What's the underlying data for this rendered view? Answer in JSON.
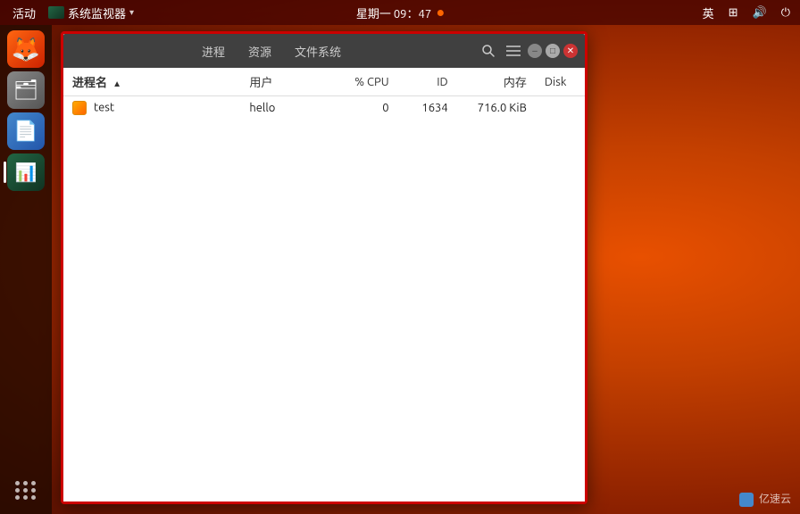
{
  "topbar": {
    "activities": "活动",
    "app_title": "系统监视器",
    "datetime": "星期一 09：47",
    "lang": "英",
    "icons": {
      "network": "network-icon",
      "volume": "volume-icon",
      "power": "power-icon"
    }
  },
  "sidebar": {
    "items": [
      {
        "name": "firefox",
        "label": "Firefox"
      },
      {
        "name": "files",
        "label": "文件管理器"
      },
      {
        "name": "writer",
        "label": "LibreOffice Writer"
      },
      {
        "name": "monitor",
        "label": "系统监视器",
        "active": true
      }
    ],
    "apps_grid_label": "显示应用程序"
  },
  "window": {
    "title": "系统监视器",
    "tabs": [
      {
        "label": "进程"
      },
      {
        "label": "资源"
      },
      {
        "label": "文件系统"
      }
    ],
    "toolbar": {
      "search": "搜索",
      "menu": "菜单",
      "minimize": "最小化",
      "maximize": "最大化",
      "close": "关闭"
    },
    "table": {
      "columns": [
        {
          "key": "name",
          "label": "进程名",
          "sorted": true
        },
        {
          "key": "user",
          "label": "用户"
        },
        {
          "key": "cpu",
          "label": "% CPU"
        },
        {
          "key": "id",
          "label": "ID"
        },
        {
          "key": "mem",
          "label": "内存"
        },
        {
          "key": "disk",
          "label": "Disk"
        }
      ],
      "rows": [
        {
          "name": "test",
          "user": "hello",
          "cpu": "0",
          "id": "1634",
          "mem": "716.0 KiB",
          "disk": ""
        }
      ]
    }
  },
  "watermark": {
    "text": "亿速云"
  }
}
